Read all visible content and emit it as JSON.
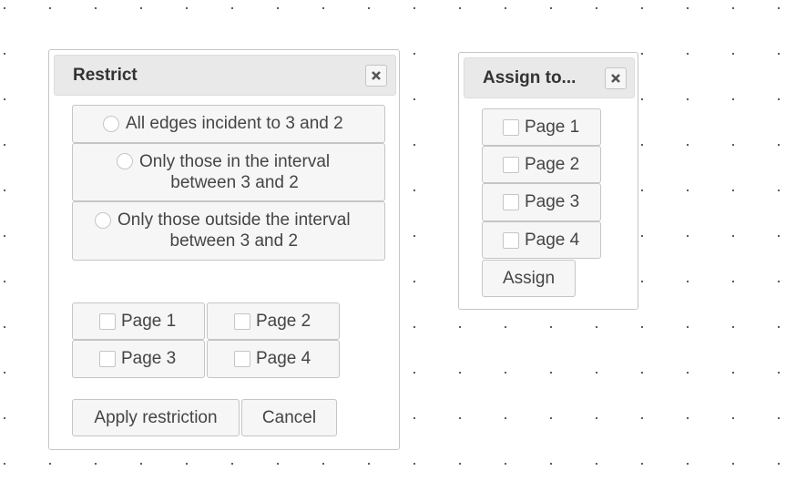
{
  "restrict_dialog": {
    "title": "Restrict",
    "radio_options": [
      {
        "line1": "All edges incident to 3 and 2",
        "line2": ""
      },
      {
        "line1": "Only those in the interval",
        "line2": "between 3 and 2"
      },
      {
        "line1": "Only those outside the interval",
        "line2": "between 3 and 2"
      }
    ],
    "page_checkboxes": [
      "Page 1",
      "Page 2",
      "Page 3",
      "Page 4"
    ],
    "apply_label": "Apply restriction",
    "cancel_label": "Cancel"
  },
  "assign_dialog": {
    "title": "Assign to...",
    "page_checkboxes": [
      "Page 1",
      "Page 2",
      "Page 3",
      "Page 4"
    ],
    "assign_label": "Assign"
  }
}
